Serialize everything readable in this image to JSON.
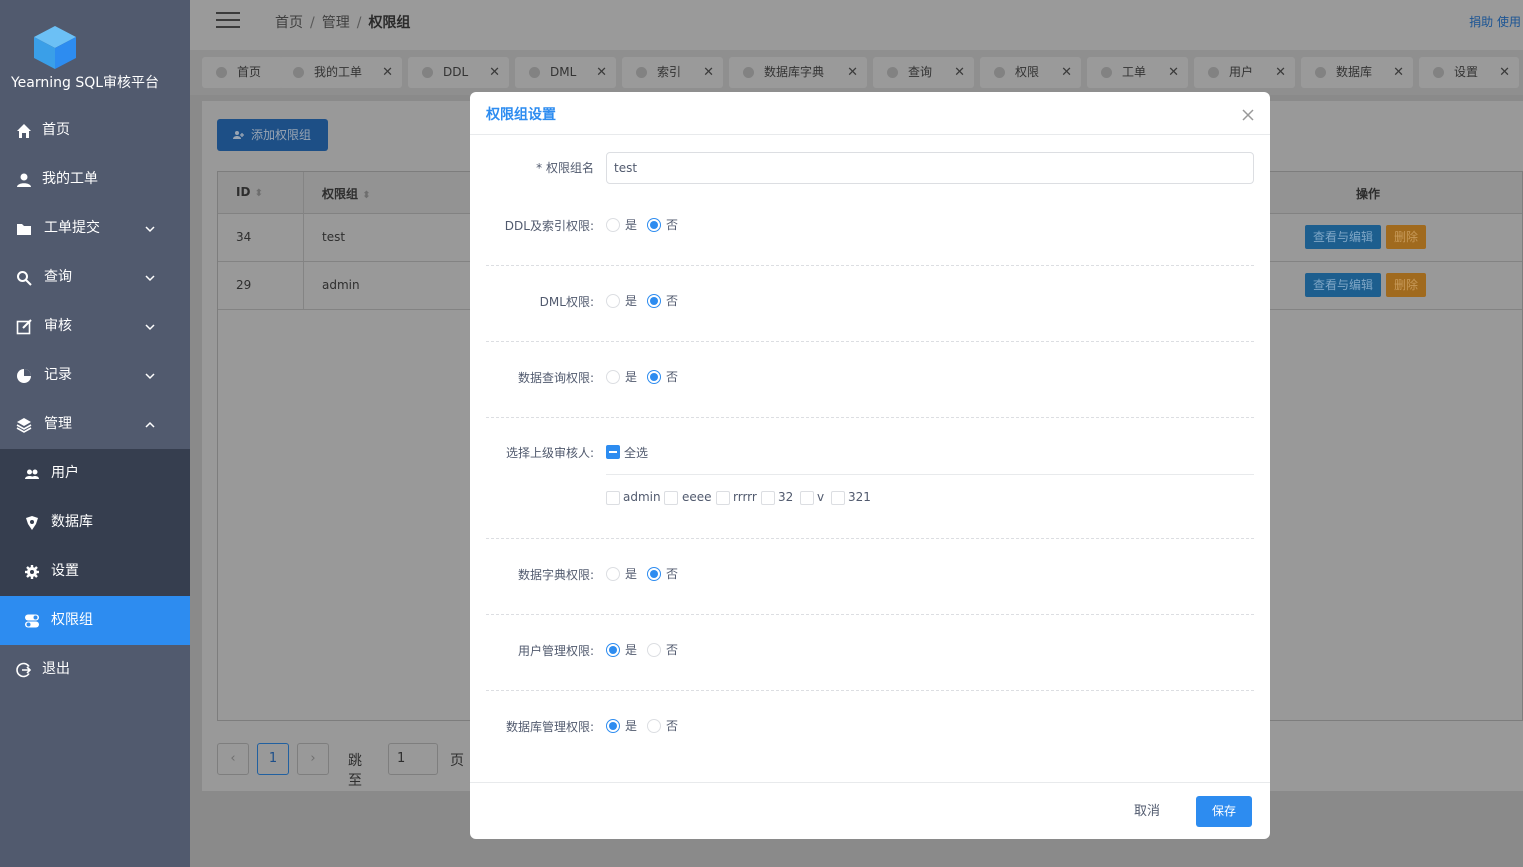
{
  "app": {
    "name": "Yearning SQL审核平台"
  },
  "sidebar": {
    "items": [
      {
        "label": "首页",
        "icon": "home-icon"
      },
      {
        "label": "我的工单",
        "icon": "user-icon"
      },
      {
        "label": "工单提交",
        "icon": "folder-icon"
      },
      {
        "label": "查询",
        "icon": "search-icon"
      },
      {
        "label": "审核",
        "icon": "edit-icon"
      },
      {
        "label": "记录",
        "icon": "pie-chart-icon"
      },
      {
        "label": "管理",
        "icon": "layers-icon"
      }
    ],
    "submenu": [
      {
        "label": "用户",
        "icon": "people-icon"
      },
      {
        "label": "数据库",
        "icon": "database-icon"
      },
      {
        "label": "设置",
        "icon": "gear-icon"
      },
      {
        "label": "权限组",
        "icon": "toggle-icon"
      }
    ],
    "logout": "退出"
  },
  "header": {
    "breadcrumb": [
      "首页",
      "管理",
      "权限组"
    ],
    "right_text": "捐助 使用"
  },
  "tags": [
    {
      "label": "首页",
      "closable": false
    },
    {
      "label": "我的工单",
      "closable": true
    },
    {
      "label": "DDL",
      "closable": true
    },
    {
      "label": "DML",
      "closable": true
    },
    {
      "label": "索引",
      "closable": true
    },
    {
      "label": "数据库字典",
      "closable": true
    },
    {
      "label": "查询",
      "closable": true
    },
    {
      "label": "权限",
      "closable": true
    },
    {
      "label": "工单",
      "closable": true
    },
    {
      "label": "用户",
      "closable": true
    },
    {
      "label": "数据库",
      "closable": true
    },
    {
      "label": "设置",
      "closable": true
    }
  ],
  "content": {
    "add_button": "添加权限组",
    "table": {
      "headers": {
        "id": "ID",
        "group": "权限组",
        "ops": "操作"
      },
      "rows": [
        {
          "id": "34",
          "name": "test"
        },
        {
          "id": "29",
          "name": "admin"
        }
      ],
      "edit_label": "查看与编辑",
      "delete_label": "删除"
    },
    "pager": {
      "current": "1",
      "jump_label": "跳至",
      "jump_value": "1",
      "page_suffix": "页"
    }
  },
  "modal": {
    "title": "权限组设置",
    "name_label": "* 权限组名",
    "name_value": "test",
    "yes": "是",
    "no": "否",
    "fields": {
      "ddl": {
        "label": "DDL及索引权限:",
        "value": "否"
      },
      "dml": {
        "label": "DML权限:",
        "value": "否"
      },
      "query": {
        "label": "数据查询权限:",
        "value": "否"
      },
      "dict": {
        "label": "数据字典权限:",
        "value": "否"
      },
      "user": {
        "label": "用户管理权限:",
        "value": "是"
      },
      "db": {
        "label": "数据库管理权限:",
        "value": "是"
      }
    },
    "auditors": {
      "label": "选择上级审核人:",
      "select_all": "全选",
      "options": [
        "admin",
        "eeee",
        "rrrrr",
        "32",
        "v",
        "321"
      ]
    },
    "cancel": "取消",
    "save": "保存"
  },
  "colors": {
    "accent": "#2d8cf0",
    "sidebar": "#515a6e",
    "submenu": "#363e4f"
  }
}
